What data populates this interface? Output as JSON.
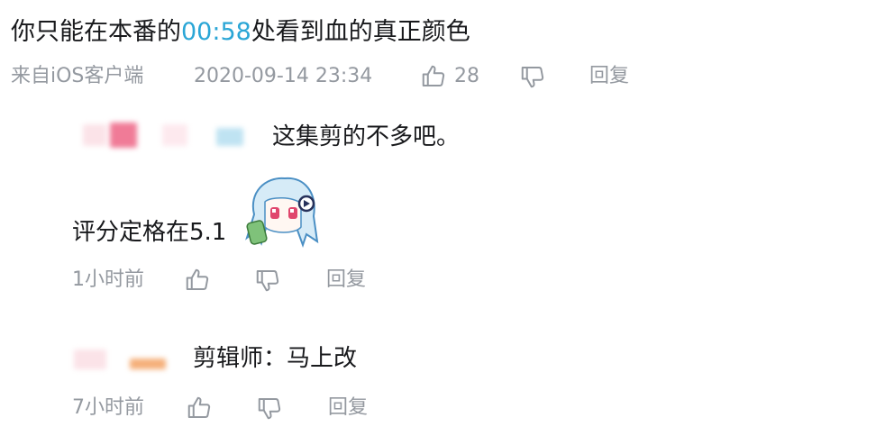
{
  "comment": {
    "text_before": "你只能在本番的",
    "timestamp_link": "00:58",
    "text_after": "处看到血的真正颜色",
    "source": "来自iOS客户端",
    "datetime": "2020-09-14 23:34",
    "like_count": "28",
    "reply_label": "回复"
  },
  "replies": [
    {
      "text": "这集剪的不多吧。"
    },
    {
      "text": "评分定格在5.1",
      "time": "1小时前",
      "reply_label": "回复"
    },
    {
      "text": "剪辑师：马上改",
      "time": "7小时前",
      "reply_label": "回复"
    }
  ],
  "colors": {
    "link": "#2aa6d6",
    "meta": "#9499a0",
    "text": "#18191c"
  },
  "icons": [
    "thumbs-up-icon",
    "thumbs-down-icon",
    "sticker-image"
  ]
}
